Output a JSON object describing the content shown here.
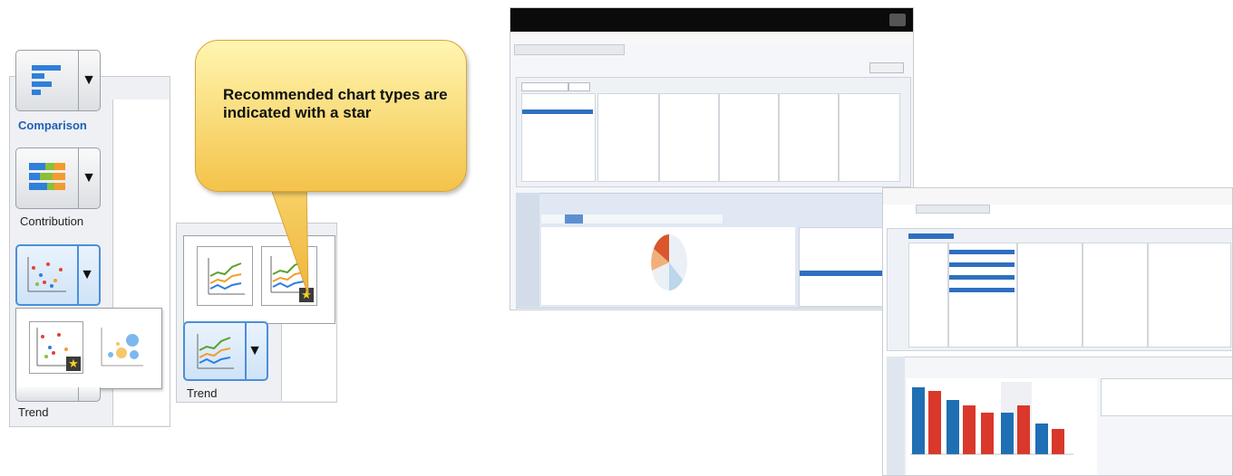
{
  "callout": {
    "text": "Recommended chart types are indicated with a star"
  },
  "left_panel": {
    "labels": {
      "comparison": "Comparison",
      "contribution": "Contribution",
      "trend": "Trend"
    },
    "dropdown_glyph": "▼",
    "star_glyph": "★"
  },
  "trend_panel": {
    "label": "Trend",
    "dropdown_glyph": "▼",
    "star_glyph": "★"
  },
  "icons": {
    "comparison": "bar-chart-icon",
    "contribution": "stacked-bar-chart-icon",
    "correlation": "scatter-chart-icon",
    "bubble": "bubble-chart-icon",
    "trend": "line-chart-icon"
  },
  "colors": {
    "accent": "#4a8fd9",
    "label_active": "#1f5fb8",
    "callout_top": "#fff6b0",
    "callout_bottom": "#f4c34a",
    "star_bg": "#3b3b3b",
    "star": "#ffd21f",
    "bar_blue": "#1f6fb5",
    "bar_red": "#d9382a"
  }
}
